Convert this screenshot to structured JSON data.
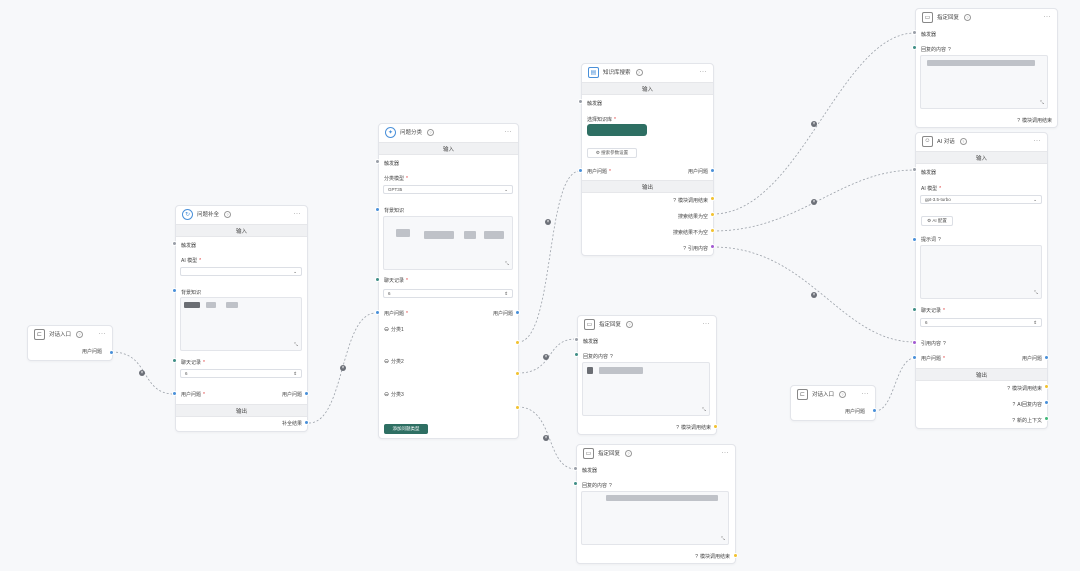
{
  "nodes": {
    "entry1": {
      "title": "对话入口",
      "output": "用户问题"
    },
    "complete": {
      "title": "问题补全",
      "input_band": "输入",
      "trigger": "触发器",
      "ai_model_label": "AI 模型",
      "bg_label": "背景知识",
      "history_label": "聊天记录",
      "history_value": "6",
      "user_q": "用户问题",
      "user_q_right": "用户问题",
      "output_band": "输出",
      "result": "补全结果"
    },
    "classify": {
      "title": "问题分类",
      "input_band": "输入",
      "trigger": "触发器",
      "model_label": "分类模型",
      "model_value": "GPT35",
      "bg_label": "背景知识",
      "history_label": "聊天记录",
      "history_value": "6",
      "user_q": "用户问题",
      "user_q_right": "用户问题",
      "cat1": "分类1",
      "cat2": "分类2",
      "cat3": "分类3",
      "add_btn": "添加问题类型"
    },
    "kb": {
      "title": "知识库搜索",
      "input_band": "输入",
      "trigger": "触发器",
      "select_label": "选择知识库",
      "param_btn": "搜索参数设置",
      "user_q": "用户问题",
      "user_q_right": "用户问题",
      "output_band": "输出",
      "out1": "模块调用结束",
      "out2": "搜索结果为空",
      "out3": "搜索结果不为空",
      "out4": "引用内容"
    },
    "reply_top": {
      "title": "指定回复",
      "trigger": "触发器",
      "content_label": "回复的内容",
      "end": "模块调用结束"
    },
    "reply_mid": {
      "title": "指定回复",
      "trigger": "触发器",
      "content_label": "回复的内容",
      "end": "模块调用结束"
    },
    "reply_bottom": {
      "title": "指定回复",
      "trigger": "触发器",
      "content_label": "回复的内容",
      "end": "模块调用结束"
    },
    "ai_chat": {
      "title": "AI 对话",
      "input_band": "输入",
      "trigger": "触发器",
      "model_label": "AI 模型",
      "model_value": "gpt-3.5-turbo",
      "config_btn": "AI 配置",
      "prompt_label": "提示词",
      "history_label": "聊天记录",
      "history_value": "6",
      "quote": "引用内容",
      "user_q": "用户问题",
      "user_q_right": "用户问题",
      "output_band": "输出",
      "out1": "模块调用结束",
      "out2": "AI回复内容",
      "out3": "新的上下文"
    },
    "entry2": {
      "title": "对话入口",
      "output": "用户问题"
    }
  },
  "colors": {
    "accent": "#2e6f63",
    "blue": "#4a90d9",
    "yellow": "#f2c230",
    "purple": "#a25ad1",
    "green": "#43b87a"
  }
}
